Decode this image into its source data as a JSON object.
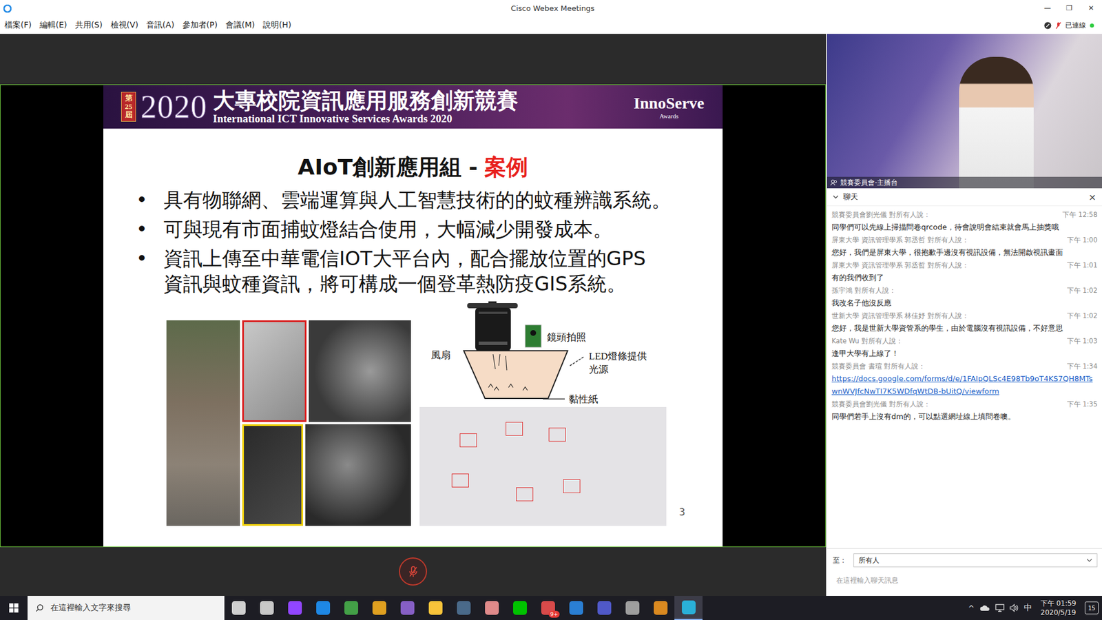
{
  "window": {
    "title": "Cisco Webex Meetings",
    "controls": [
      "—",
      "❐",
      "✕"
    ]
  },
  "menu": [
    "檔案(F)",
    "編輯(E)",
    "共用(S)",
    "檢視(V)",
    "音訊(A)",
    "參加者(P)",
    "會議(M)",
    "說明(H)"
  ],
  "connection": {
    "label": "已連線",
    "connected": true
  },
  "slide": {
    "banner": {
      "edition_top": "第",
      "edition_num": "25",
      "edition_bottom": "屆",
      "year": "2020",
      "title": "大專校院資訊應用服務創新競賽",
      "subtitle": "International ICT Innovative Services Awards 2020",
      "brand": "InnoServe",
      "brand_sub": "Awards"
    },
    "title": "AIoT創新應用組",
    "separator": "-",
    "highlight": "案例",
    "bullets": [
      {
        "lines": [
          "具有物聯網、雲端運算與人工智慧技術的的蚊種辨識系統。"
        ]
      },
      {
        "lines": [
          "可與現有市面捕蚊燈結合使用，大幅減少開發成本。"
        ]
      },
      {
        "lines": [
          "資訊上傳至中華電信IOT大平台內，配合擺放位置的GPS",
          "資訊與蚊種資訊，將可構成一個登革熱防疫GIS系統。"
        ]
      }
    ],
    "diagram": {
      "camera": "鏡頭拍照",
      "fan": "風扇",
      "led": "LED燈條提供",
      "led2": "光源",
      "paper": "黏性紙"
    },
    "page": "3"
  },
  "mute": {
    "muted": true
  },
  "video": {
    "label": "競賽委員會-主播台"
  },
  "chat": {
    "title": "聊天",
    "close": "×",
    "messages": [
      {
        "sender": "競賽委員會劉光儀 對所有人說：",
        "time": "下午 12:58",
        "text": "同學們可以先線上掃描問卷qrcode，待會說明會結束就會馬上抽獎哦",
        "kind": "text"
      },
      {
        "sender": "屏東大學 資訊管理學系 郭丞哲 對所有人說：",
        "time": "下午 1:00",
        "text": "您好，我們是屏東大學，很抱歉手邊沒有視訊設備，無法開啟視訊畫面",
        "kind": "text"
      },
      {
        "sender": "屏東大學 資訊管理學系 郭丞哲 對所有人說：",
        "time": "下午 1:01",
        "text": "有的我們收到了",
        "kind": "text"
      },
      {
        "sender": "孫宇鴻 對所有人說：",
        "time": "下午 1:02",
        "text": "我改名子他沒反應",
        "kind": "text"
      },
      {
        "sender": "世新大學 資訊管理學系 林佳妤 對所有人說：",
        "time": "下午 1:02",
        "text": "您好，我是世新大學資管系的學生，由於電腦沒有視訊設備，不好意思",
        "kind": "text"
      },
      {
        "sender": "Kate Wu 對所有人說：",
        "time": "下午 1:03",
        "text": "逢甲大學有上線了！",
        "kind": "text"
      },
      {
        "sender": "競賽委員會 書瑄 對所有人說：",
        "time": "下午 1:34",
        "text": "https://docs.google.com/forms/d/e/1FAIpQLSc4E98Tb9oT4KS7QH8MTswnWVJfcNwTI7K5WDfqWtDB-bUitQ/viewform",
        "kind": "link"
      },
      {
        "sender": "競賽委員會劉光儀 對所有人說：",
        "time": "下午 1:35",
        "text": "同學們若手上沒有dm的，可以點選網址線上填問卷噢。",
        "kind": "text"
      }
    ],
    "to_label": "至：",
    "to_value": "所有人",
    "placeholder": "在這裡輸入聊天訊息"
  },
  "taskbar": {
    "search_placeholder": "在這裡輸入文字來搜尋",
    "apps": [
      {
        "color": "#d0d0d0",
        "active": false
      },
      {
        "color": "#c8c8c8",
        "active": false
      },
      {
        "color": "#9146ff",
        "active": false
      },
      {
        "color": "#1e88e5",
        "active": false
      },
      {
        "color": "#43a047",
        "active": false
      },
      {
        "color": "#e0a020",
        "active": false
      },
      {
        "color": "#865fc5",
        "active": false
      },
      {
        "color": "#f8c33a",
        "active": false
      },
      {
        "color": "#4a6a8a",
        "active": false
      },
      {
        "color": "#e08a8a",
        "active": false
      },
      {
        "color": "#00c300",
        "active": false
      },
      {
        "color": "#d84a4a",
        "active": false,
        "badge": "9+"
      },
      {
        "color": "#2a7fd4",
        "active": false
      },
      {
        "color": "#5059c9",
        "active": false
      },
      {
        "color": "#9e9e9e",
        "active": false
      },
      {
        "color": "#db8a20",
        "active": false
      },
      {
        "color": "#2ab0d8",
        "active": true
      }
    ],
    "tray_up": "^",
    "ime": "中",
    "time": "下午 01:59",
    "date": "2020/5/19",
    "notifications": "15"
  }
}
